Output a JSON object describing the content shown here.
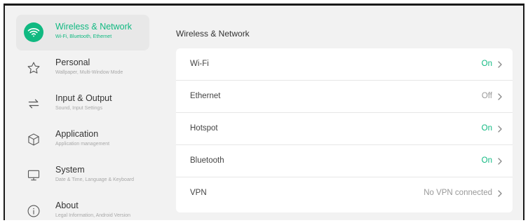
{
  "sidebar": {
    "items": [
      {
        "title": "Wireless & Network",
        "subtitle": "Wi-Fi, Bluetooth, Ethernet",
        "icon": "wifi-icon",
        "active": true
      },
      {
        "title": "Personal",
        "subtitle": "Wallpaper, Multi-Window Mode",
        "icon": "star-icon",
        "active": false
      },
      {
        "title": "Input & Output",
        "subtitle": "Sound, Input Settings",
        "icon": "swap-arrows-icon",
        "active": false
      },
      {
        "title": "Application",
        "subtitle": "Application management",
        "icon": "cube-icon",
        "active": false
      },
      {
        "title": "System",
        "subtitle": "Date & Time, Language & Keyboard",
        "icon": "monitor-icon",
        "active": false
      },
      {
        "title": "About",
        "subtitle": "Legal Information, Android Version",
        "icon": "info-icon",
        "active": false
      }
    ]
  },
  "main": {
    "title": "Wireless & Network",
    "rows": [
      {
        "label": "Wi-Fi",
        "value": "On",
        "on": true
      },
      {
        "label": "Ethernet",
        "value": "Off",
        "on": false
      },
      {
        "label": "Hotspot",
        "value": "On",
        "on": true
      },
      {
        "label": "Bluetooth",
        "value": "On",
        "on": true
      },
      {
        "label": "VPN",
        "value": "No VPN connected",
        "on": false
      }
    ]
  },
  "colors": {
    "accent": "#10b981",
    "background": "#f2f2f2",
    "panel": "#ffffff"
  }
}
